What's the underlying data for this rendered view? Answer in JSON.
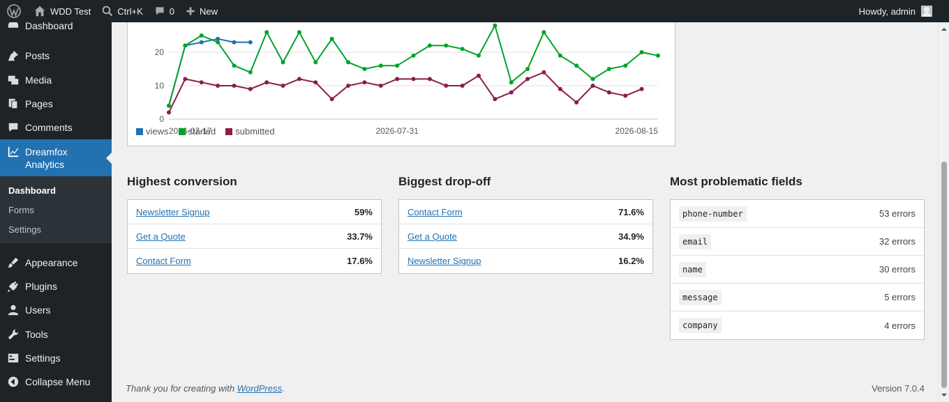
{
  "adminbar": {
    "site_name": "WDD Test",
    "search_shortcut": "Ctrl+K",
    "comments_count": "0",
    "new_label": "New",
    "howdy": "Howdy, admin"
  },
  "sidebar": {
    "items": [
      {
        "label": "Dashboard",
        "icon": "dashboard-icon"
      },
      {
        "label": "Posts",
        "icon": "pushpin-icon"
      },
      {
        "label": "Media",
        "icon": "media-icon"
      },
      {
        "label": "Pages",
        "icon": "pages-icon"
      },
      {
        "label": "Comments",
        "icon": "comment-icon"
      },
      {
        "label": "Dreamfox Analytics",
        "icon": "chart-icon",
        "current": true
      },
      {
        "label": "Appearance",
        "icon": "paintbrush-icon"
      },
      {
        "label": "Plugins",
        "icon": "plug-icon"
      },
      {
        "label": "Users",
        "icon": "user-icon"
      },
      {
        "label": "Tools",
        "icon": "wrench-icon"
      },
      {
        "label": "Settings",
        "icon": "settings-icon"
      },
      {
        "label": "Collapse Menu",
        "icon": "collapse-icon"
      }
    ],
    "submenu": [
      {
        "label": "Dashboard",
        "active": true
      },
      {
        "label": "Forms"
      },
      {
        "label": "Settings"
      }
    ]
  },
  "chart_data": {
    "type": "line",
    "title": "",
    "xlabel": "",
    "ylabel": "",
    "x_tick_labels": [
      "2026-07-17",
      "2026-07-31",
      "2026-08-15"
    ],
    "y_ticks": [
      0,
      10,
      20
    ],
    "grid": true,
    "legend_placement": "bottom-left",
    "series": [
      {
        "name": "views",
        "color": "#2271b1",
        "values": [
          4,
          22,
          23,
          24,
          23,
          23
        ]
      },
      {
        "name": "started",
        "color": "#00a32a",
        "values": [
          4,
          22,
          25,
          23,
          16,
          14,
          26,
          17,
          26,
          17,
          24,
          17,
          15,
          16,
          16,
          19,
          22,
          22,
          21,
          19,
          28,
          11,
          15,
          26,
          19,
          16,
          12,
          15,
          16,
          20,
          19
        ]
      },
      {
        "name": "submitted",
        "color": "#8a1d4a",
        "values": [
          2,
          12,
          11,
          10,
          10,
          9,
          11,
          10,
          12,
          11,
          6,
          10,
          11,
          10,
          12,
          12,
          12,
          10,
          10,
          13,
          6,
          8,
          12,
          14,
          9,
          5,
          10,
          8,
          7,
          9
        ]
      }
    ]
  },
  "sections": {
    "highest": {
      "title": "Highest conversion",
      "rows": [
        {
          "name": "Newsletter Signup",
          "value": "59%"
        },
        {
          "name": "Get a Quote",
          "value": "33.7%"
        },
        {
          "name": "Contact Form",
          "value": "17.6%"
        }
      ]
    },
    "dropoff": {
      "title": "Biggest drop-off",
      "rows": [
        {
          "name": "Contact Form",
          "value": "71.6%"
        },
        {
          "name": "Get a Quote",
          "value": "34.9%"
        },
        {
          "name": "Newsletter Signup",
          "value": "16.2%"
        }
      ]
    },
    "problematic": {
      "title": "Most problematic fields",
      "rows": [
        {
          "field": "phone-number",
          "errors": "53 errors"
        },
        {
          "field": "email",
          "errors": "32 errors"
        },
        {
          "field": "name",
          "errors": "30 errors"
        },
        {
          "field": "message",
          "errors": "5 errors"
        },
        {
          "field": "company",
          "errors": "4 errors"
        }
      ]
    }
  },
  "footer": {
    "thanks_prefix": "Thank you for creating with ",
    "thanks_link": "WordPress",
    "thanks_suffix": ".",
    "version": "Version 7.0.4"
  }
}
